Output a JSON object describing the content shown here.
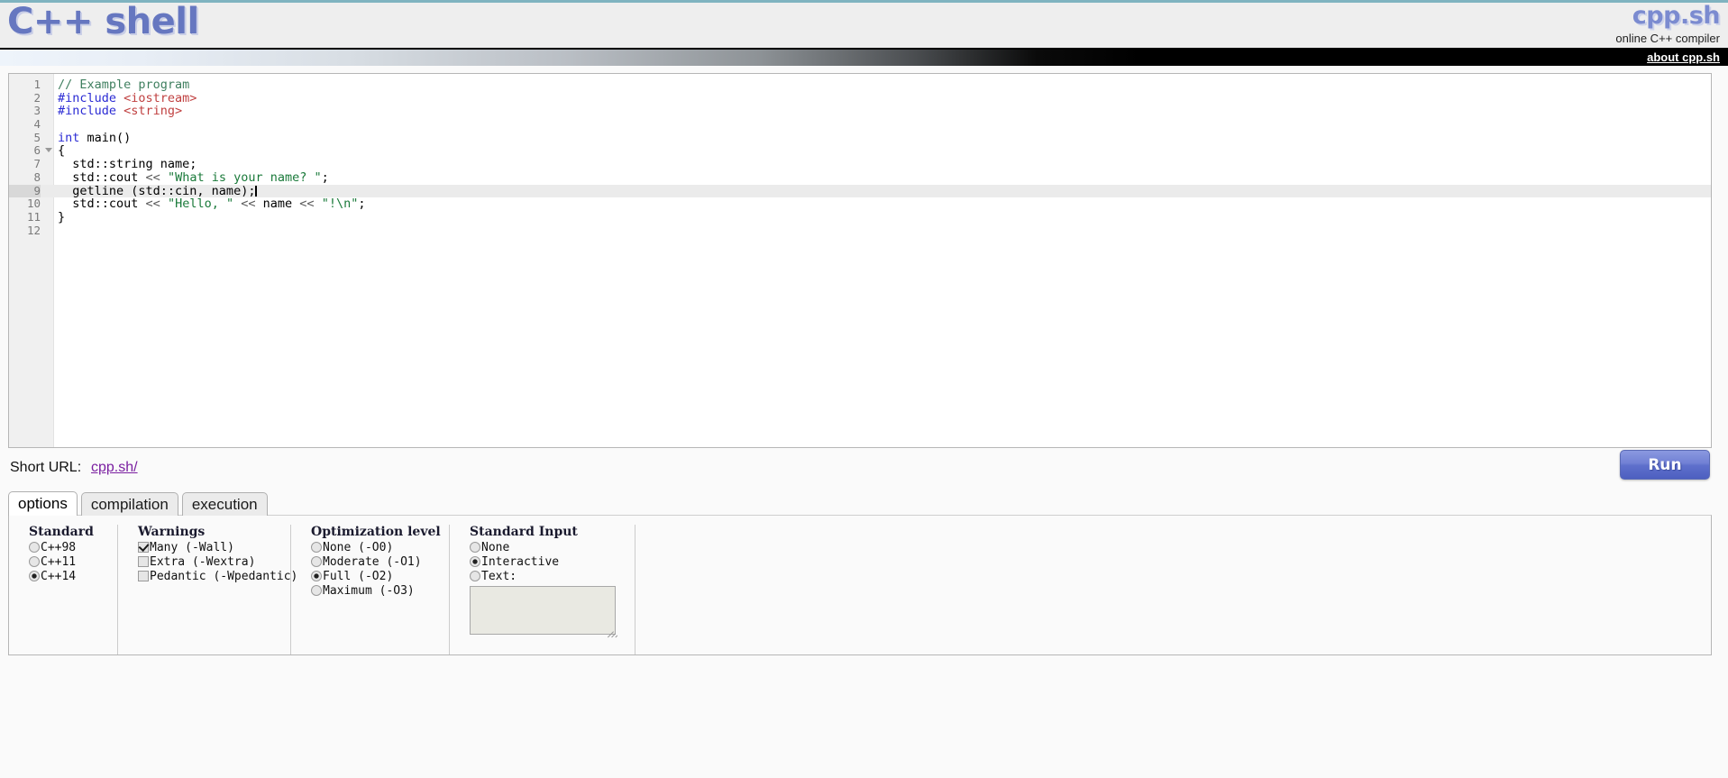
{
  "header": {
    "logo": "C++ shell",
    "brand_name": "cpp.sh",
    "brand_sub": "online C++ compiler",
    "about_link": "about cpp.sh"
  },
  "editor": {
    "active_line": 9,
    "total_lines": 12,
    "lines": [
      {
        "num": "1",
        "tokens": [
          {
            "t": "// Example program",
            "c": "cm"
          }
        ]
      },
      {
        "num": "2",
        "tokens": [
          {
            "t": "#include ",
            "c": "pp"
          },
          {
            "t": "<iostream>",
            "c": "hdr"
          }
        ]
      },
      {
        "num": "3",
        "tokens": [
          {
            "t": "#include ",
            "c": "pp"
          },
          {
            "t": "<string>",
            "c": "hdr"
          }
        ]
      },
      {
        "num": "4",
        "tokens": []
      },
      {
        "num": "5",
        "tokens": [
          {
            "t": "int",
            "c": "kw"
          },
          {
            "t": " main()",
            "c": "pl"
          }
        ]
      },
      {
        "num": "6",
        "fold": true,
        "tokens": [
          {
            "t": "{",
            "c": "pl"
          }
        ]
      },
      {
        "num": "7",
        "tokens": [
          {
            "t": "  std::string name;",
            "c": "pl"
          }
        ]
      },
      {
        "num": "8",
        "tokens": [
          {
            "t": "  std::cout ",
            "c": "pl"
          },
          {
            "t": "<<",
            "c": "op"
          },
          {
            "t": " ",
            "c": "pl"
          },
          {
            "t": "\"What is your name? \"",
            "c": "str"
          },
          {
            "t": ";",
            "c": "pl"
          }
        ]
      },
      {
        "num": "9",
        "tokens": [
          {
            "t": "  getline (std::cin, name);",
            "c": "pl"
          }
        ],
        "caret": true
      },
      {
        "num": "10",
        "tokens": [
          {
            "t": "  std::cout ",
            "c": "pl"
          },
          {
            "t": "<<",
            "c": "op"
          },
          {
            "t": " ",
            "c": "pl"
          },
          {
            "t": "\"Hello, \"",
            "c": "str"
          },
          {
            "t": " ",
            "c": "pl"
          },
          {
            "t": "<<",
            "c": "op"
          },
          {
            "t": " name ",
            "c": "pl"
          },
          {
            "t": "<<",
            "c": "op"
          },
          {
            "t": " ",
            "c": "pl"
          },
          {
            "t": "\"!\\n\"",
            "c": "str"
          },
          {
            "t": ";",
            "c": "pl"
          }
        ]
      },
      {
        "num": "11",
        "tokens": [
          {
            "t": "}",
            "c": "pl"
          }
        ]
      },
      {
        "num": "12",
        "tokens": []
      }
    ]
  },
  "short_url": {
    "label": "Short URL:",
    "link_text": "cpp.sh/"
  },
  "run": {
    "label": "Run"
  },
  "tabs": [
    {
      "label": "options",
      "active": true
    },
    {
      "label": "compilation",
      "active": false
    },
    {
      "label": "execution",
      "active": false
    }
  ],
  "options": {
    "standard": {
      "title": "Standard",
      "items": [
        {
          "label": "C++98",
          "selected": false
        },
        {
          "label": "C++11",
          "selected": false
        },
        {
          "label": "C++14",
          "selected": true
        }
      ]
    },
    "warnings": {
      "title": "Warnings",
      "items": [
        {
          "label": "Many (-Wall)",
          "checked": true
        },
        {
          "label": "Extra (-Wextra)",
          "checked": false
        },
        {
          "label": "Pedantic (-Wpedantic)",
          "checked": false
        }
      ]
    },
    "optimization": {
      "title": "Optimization level",
      "items": [
        {
          "label": "None (-O0)",
          "selected": false
        },
        {
          "label": "Moderate (-O1)",
          "selected": false
        },
        {
          "label": "Full (-O2)",
          "selected": true
        },
        {
          "label": "Maximum (-O3)",
          "selected": false
        }
      ]
    },
    "standard_input": {
      "title": "Standard Input",
      "items": [
        {
          "label": "None",
          "selected": false
        },
        {
          "label": "Interactive",
          "selected": true
        },
        {
          "label": "Text:",
          "selected": false
        }
      ],
      "textarea_value": "",
      "textarea_placeholder": ""
    }
  },
  "colors": {
    "accent": "#6677c0",
    "link": "#7a1fa0",
    "run_button": "#5f70cc",
    "topline": "#7fb3c0"
  }
}
